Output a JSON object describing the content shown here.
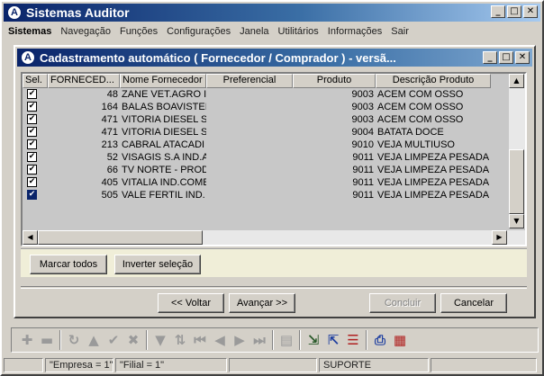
{
  "app": {
    "title": "Sistemas Auditor",
    "icon_letter": "A"
  },
  "menu": [
    "Sistemas",
    "Navegação",
    "Funções",
    "Configurações",
    "Janela",
    "Utilitários",
    "Informações",
    "Sair"
  ],
  "child_window": {
    "title": "Cadastramento automático ( Fornecedor / Comprador ) - versã..."
  },
  "grid": {
    "columns": [
      "Sel.",
      "FORNECED...",
      "Nome Fornecedor",
      "Preferencial",
      "Produto",
      "Descrição Produto"
    ],
    "rows": [
      {
        "checked": true,
        "fornecedor": "48",
        "nome": "ZANE VET.AGRO I",
        "preferencial": "",
        "produto": "9003",
        "descricao": "ACEM COM OSSO"
      },
      {
        "checked": true,
        "fornecedor": "164",
        "nome": "BALAS BOAVISTEI",
        "preferencial": "",
        "produto": "9003",
        "descricao": "ACEM COM OSSO"
      },
      {
        "checked": true,
        "fornecedor": "471",
        "nome": "VITORIA DIESEL S",
        "preferencial": "",
        "produto": "9003",
        "descricao": "ACEM COM OSSO"
      },
      {
        "checked": true,
        "fornecedor": "471",
        "nome": "VITORIA DIESEL S",
        "preferencial": "",
        "produto": "9004",
        "descricao": "BATATA DOCE"
      },
      {
        "checked": true,
        "fornecedor": "213",
        "nome": "CABRAL ATACADI",
        "preferencial": "",
        "produto": "9010",
        "descricao": "VEJA MULTIUSO"
      },
      {
        "checked": true,
        "fornecedor": "52",
        "nome": "VISAGIS S.A IND.A",
        "preferencial": "",
        "produto": "9011",
        "descricao": "VEJA LIMPEZA PESADA"
      },
      {
        "checked": true,
        "fornecedor": "66",
        "nome": "TV NORTE - PROD",
        "preferencial": "",
        "produto": "9011",
        "descricao": "VEJA LIMPEZA PESADA"
      },
      {
        "checked": true,
        "fornecedor": "405",
        "nome": "VITALIA IND.COME",
        "preferencial": "",
        "produto": "9011",
        "descricao": "VEJA LIMPEZA PESADA"
      },
      {
        "checked": true,
        "fornecedor": "505",
        "nome": "VALE FERTIL IND.",
        "preferencial": "",
        "produto": "9011",
        "descricao": "VEJA LIMPEZA PESADA"
      }
    ],
    "check_mark": "✔"
  },
  "actions": {
    "mark_all": "Marcar todos",
    "invert": "Inverter seleção"
  },
  "wizard": {
    "back": "<< Voltar",
    "next": "Avançar >>",
    "finish": "Concluir",
    "cancel": "Cancelar"
  },
  "status": {
    "panel1": "",
    "empresa": "\"Empresa = 1\"",
    "filial": "\"Filial = 1\"",
    "panel4": "",
    "user": "SUPORTE",
    "panel6": ""
  },
  "window_controls": {
    "minimize": "_",
    "maximize": "□",
    "close": "✕"
  },
  "scroll_glyphs": {
    "up": "▲",
    "down": "▼",
    "left": "◀",
    "right": "▶"
  },
  "toolbar_icons": [
    "add-icon",
    "remove-icon",
    "refresh-icon",
    "triangle-up-icon",
    "confirm-icon",
    "cancel-icon",
    "filter-icon",
    "sort-icon",
    "first-record-icon",
    "prev-record-icon",
    "next-record-icon",
    "last-record-icon",
    "document-icon",
    "import-icon",
    "export-icon",
    "delete-list-icon",
    "print-icon",
    "report-icon"
  ],
  "toolbar_glyphs": {
    "add": "✚",
    "remove": "▬",
    "refresh": "↻",
    "up": "▲",
    "ok": "✔",
    "cancel": "✖",
    "filter": "▼",
    "sort": "⇅",
    "first": "⏮",
    "prev": "◀",
    "next": "▶",
    "last": "⏭",
    "doc": "▤",
    "import": "⇲",
    "export": "⇱",
    "dellist": "☰",
    "print": "⎙",
    "report": "▦"
  }
}
